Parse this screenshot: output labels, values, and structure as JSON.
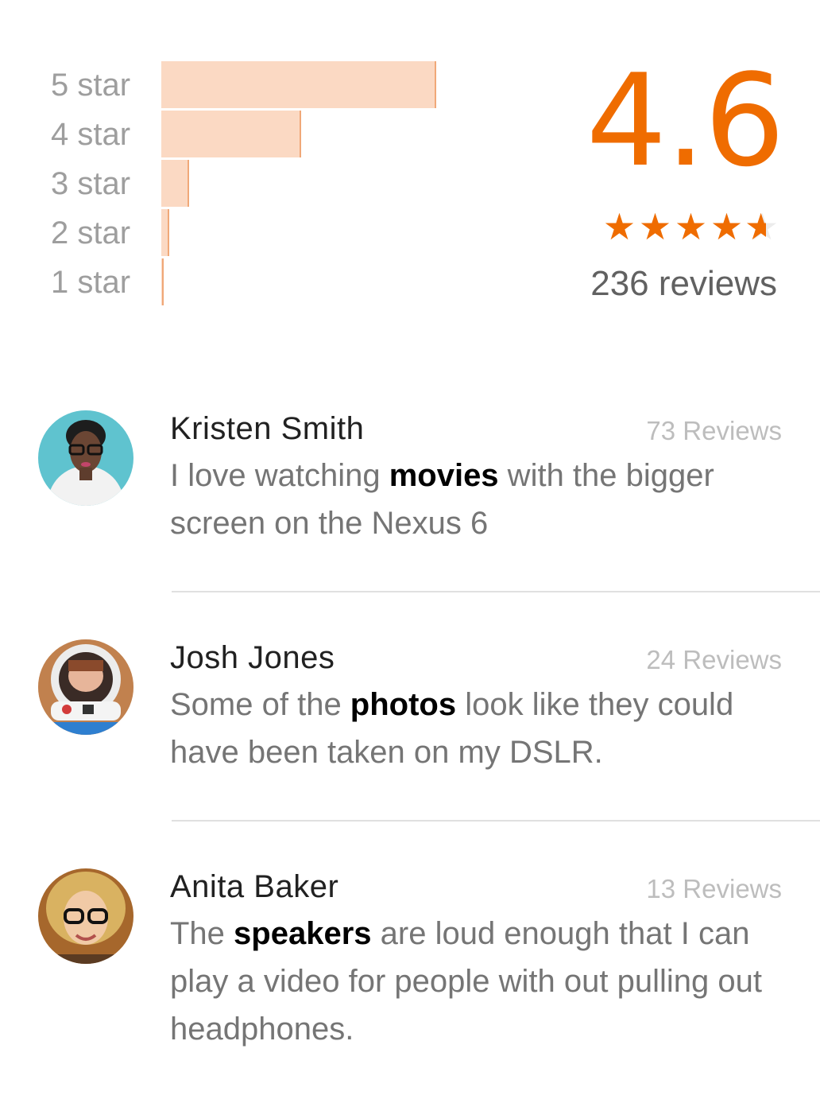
{
  "rating": {
    "score": "4.6",
    "score_value": 4.6,
    "review_count": "236 reviews",
    "accent_color": "#ef6c00",
    "bar_color": "#fbd9c3",
    "distribution": [
      {
        "label": "5 star",
        "fraction": 1.0
      },
      {
        "label": "4 star",
        "fraction": 0.51
      },
      {
        "label": "3 star",
        "fraction": 0.1
      },
      {
        "label": "2 star",
        "fraction": 0.03
      },
      {
        "label": "1 star",
        "fraction": 0.01
      }
    ],
    "stars": {
      "max": 5,
      "value": 4.6,
      "icon": "star-icon"
    }
  },
  "reviews": [
    {
      "name": "Kristen Smith",
      "count": "73 Reviews",
      "text_before": "I love watching ",
      "highlight": "movies",
      "text_after": " with the bigger screen on the Nexus 6",
      "avatar": "avatar-kristen"
    },
    {
      "name": "Josh Jones",
      "count": "24 Reviews",
      "text_before": "Some of the ",
      "highlight": "photos",
      "text_after": " look like they could have been taken on my DSLR.",
      "avatar": "avatar-josh"
    },
    {
      "name": "Anita Baker",
      "count": "13 Reviews",
      "text_before": "The ",
      "highlight": "speakers",
      "text_after": " are loud enough that I can play a video for people with out pulling out headphones.",
      "avatar": "avatar-anita"
    }
  ]
}
